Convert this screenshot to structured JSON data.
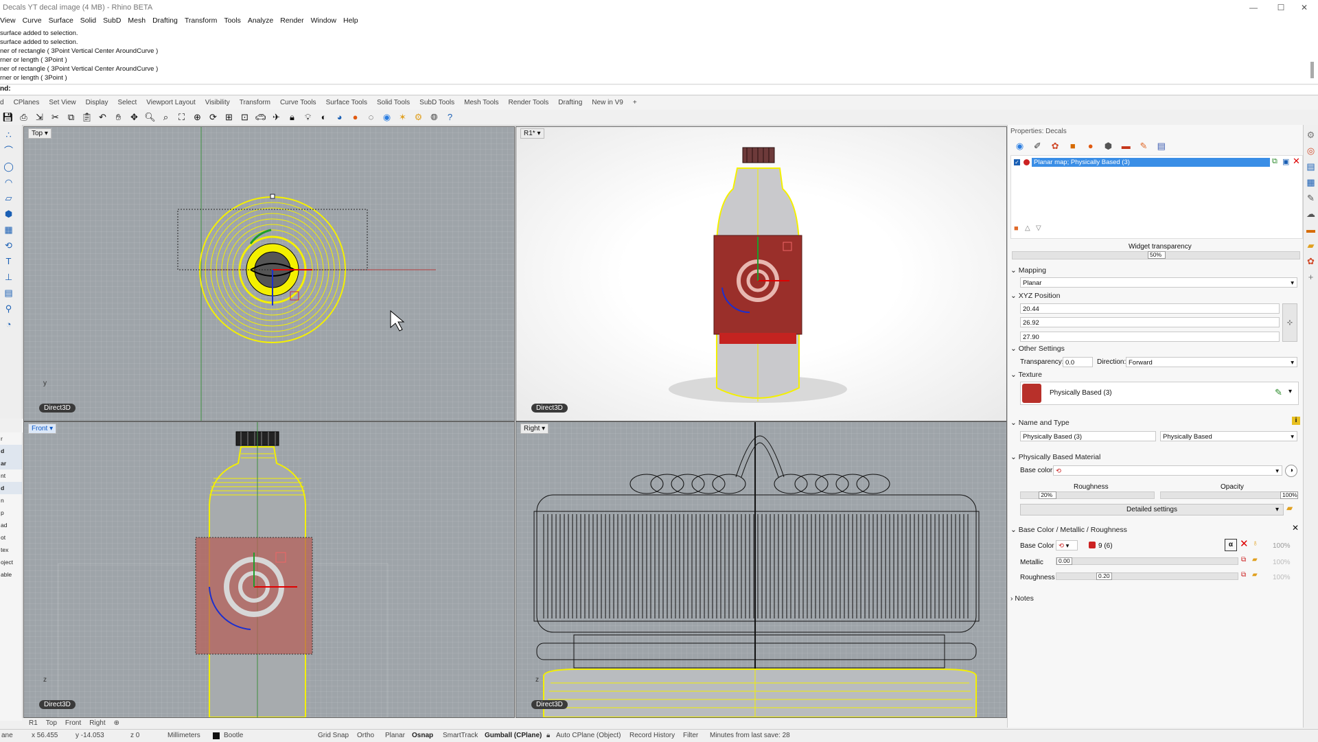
{
  "window": {
    "title": "Decals YT decal image (4 MB) - Rhino BETA",
    "minimize": "—",
    "maximize": "☐",
    "close": "✕"
  },
  "menu": [
    "View",
    "Curve",
    "Surface",
    "Solid",
    "SubD",
    "Mesh",
    "Drafting",
    "Transform",
    "Tools",
    "Analyze",
    "Render",
    "Window",
    "Help"
  ],
  "command_history": [
    "surface added to selection.",
    "surface added to selection.",
    "ner of rectangle ( 3Point  Vertical  Center  AroundCurve )",
    "rner or length ( 3Point )",
    "ner of rectangle ( 3Point  Vertical  Center  AroundCurve )",
    "rner or length ( 3Point )"
  ],
  "command_prompt": "nd:",
  "toolbar_tabs": [
    "d",
    "CPlanes",
    "Set View",
    "Display",
    "Select",
    "Viewport Layout",
    "Visibility",
    "Transform",
    "Curve Tools",
    "Surface Tools",
    "Solid Tools",
    "SubD Tools",
    "Mesh Tools",
    "Render Tools",
    "Drafting",
    "New in V9",
    "+"
  ],
  "toolbar_icons": [
    "save-icon",
    "print-icon",
    "import-icon",
    "cut-icon",
    "copy-icon",
    "paste-icon",
    "undo-icon",
    "pan-icon",
    "move-icon",
    "zoom-icon",
    "zoom-window-icon",
    "zoom-extents-icon",
    "zoom-selected-icon",
    "rotate-view-icon",
    "four-views-icon",
    "cplane-icon",
    "car-icon",
    "plane-icon",
    "lock-icon",
    "light-icon",
    "shade-icon",
    "rendered-icon",
    "sphere-icon",
    "ghosted-icon",
    "material-icon",
    "star-icon",
    "settings-icon",
    "globe-icon",
    "help-icon"
  ],
  "left_tools": [
    "point-icon",
    "curve-icon",
    "circle-icon",
    "arc-icon",
    "surface-icon",
    "solid-icon",
    "mesh-icon",
    "transform-icon",
    "text-icon",
    "dimension-icon",
    "block-icon",
    "analyze-icon",
    "render-icon"
  ],
  "left_panel_items": [
    "r",
    "d",
    "ar",
    "nt",
    "d",
    "n",
    "p",
    "ad",
    "ot",
    "tex",
    "oject",
    "able"
  ],
  "viewports": {
    "top": {
      "label": "Top",
      "badge": "Direct3D",
      "axis_y": "y"
    },
    "r1": {
      "label": "R1*",
      "badge": "Direct3D"
    },
    "front": {
      "label": "Front",
      "badge": "Direct3D",
      "axis_z": "z"
    },
    "right": {
      "label": "Right",
      "badge": "Direct3D",
      "axis_z": "z"
    }
  },
  "viewport_tabs": [
    "R1",
    "Top",
    "Front",
    "Right",
    "⊕"
  ],
  "properties": {
    "header": "Properties: Decals",
    "decal_item": "Planar map; Physically Based (3)",
    "widget_transparency_label": "Widget transparency",
    "widget_transparency_value": "50%",
    "widget_transparency_fraction": 0.5,
    "mapping_section": "Mapping",
    "mapping_value": "Planar",
    "xyz_section": "XYZ Position",
    "x": "20.44",
    "y": "26.92",
    "z": "27.90",
    "other_section": "Other Settings",
    "transparency_label": "Transparency:",
    "transparency_value": "0.0",
    "direction_label": "Direction:",
    "direction_value": "Forward",
    "texture_section": "Texture",
    "texture_name": "Physically Based (3)",
    "name_type_section": "Name and Type",
    "name_value": "Physically Based (3)",
    "type_value": "Physically Based",
    "pbm_section": "Physically Based Material",
    "base_color_label": "Base color:",
    "roughness_label": "Roughness",
    "roughness_value": "20%",
    "roughness_fraction": 0.2,
    "opacity_label": "Opacity",
    "opacity_value": "100%",
    "opacity_fraction": 1.0,
    "detailed_settings": "Detailed settings",
    "bcmr_section": "Base Color /  Metallic / Roughness",
    "base_color_row": "Base Color",
    "base_color_tex": "9 (6)",
    "base_color_pct": "100%",
    "metallic_row": "Metallic",
    "metallic_value": "0.00",
    "metallic_pct": "100%",
    "roughness_row": "Roughness",
    "roughness_row_value": "0.20",
    "roughness_pct": "100%",
    "notes_section": "Notes"
  },
  "status": {
    "plane": "ane",
    "x": "x 56.455",
    "y": "y -14.053",
    "z": "z 0",
    "units": "Millimeters",
    "layer": "Bootle",
    "grid_snap": "Grid Snap",
    "ortho": "Ortho",
    "planar": "Planar",
    "osnap": "Osnap",
    "smarttrack": "SmartTrack",
    "gumball": "Gumball (CPlane)",
    "autocplane": "Auto CPlane (Object)",
    "record_history": "Record History",
    "filter": "Filter",
    "minutes": "Minutes from last save: 28"
  },
  "colors": {
    "accent": "#0b57c5",
    "yellow": "#f4f000",
    "decal_red": "#a0302b",
    "selection": "#3a8ee6"
  }
}
